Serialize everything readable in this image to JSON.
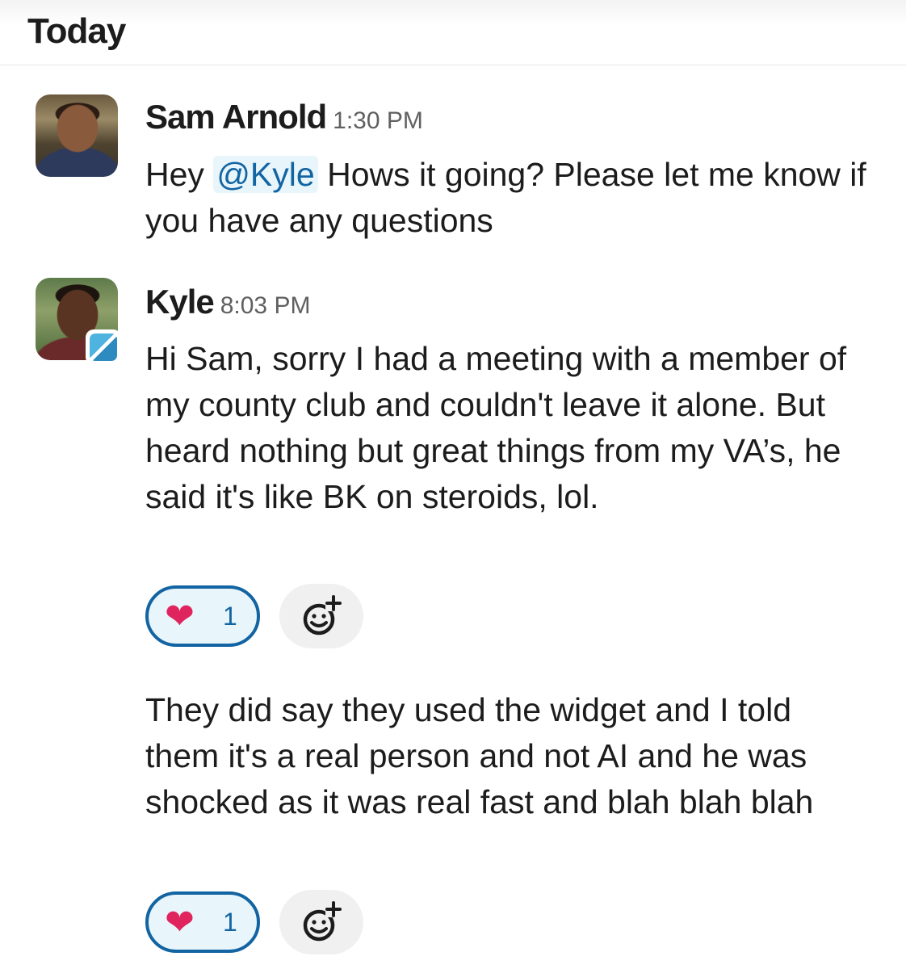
{
  "day_divider": {
    "label": "Today"
  },
  "messages": [
    {
      "author": "Sam Arnold",
      "time": "1:30 PM",
      "text_before_mention": "Hey ",
      "mention": "@Kyle",
      "text_after_mention": " Hows it going? Please let me know if you have any questions",
      "avatar_icon": "user-avatar"
    },
    {
      "author": "Kyle",
      "time": "8:03 PM",
      "avatar_icon": "user-avatar",
      "badge_icon": "app-badge-icon",
      "text": "Hi Sam, sorry I had a meeting with a member of my county club and couldn't leave it alone. But heard nothing but great things from my VA’s, he said it's like BK on steroids, lol.",
      "reaction": {
        "emoji": "❤",
        "count": "1",
        "icon": "heart-icon"
      },
      "add_reaction_icon": "add-emoji-icon"
    },
    {
      "author": "Kyle",
      "continuation": true,
      "text": "They did say they used the widget and I told them it's a real person and not AI and he was shocked as it was real fast and blah blah blah",
      "reaction": {
        "emoji": "❤",
        "count": "1",
        "icon": "heart-icon"
      },
      "add_reaction_icon": "add-emoji-icon"
    }
  ],
  "colors": {
    "mention_bg": "#e8f5fa",
    "mention_text": "#1264a3",
    "reaction_border": "#1264a3",
    "heart": "#e0245e",
    "timestamp": "#616061"
  }
}
